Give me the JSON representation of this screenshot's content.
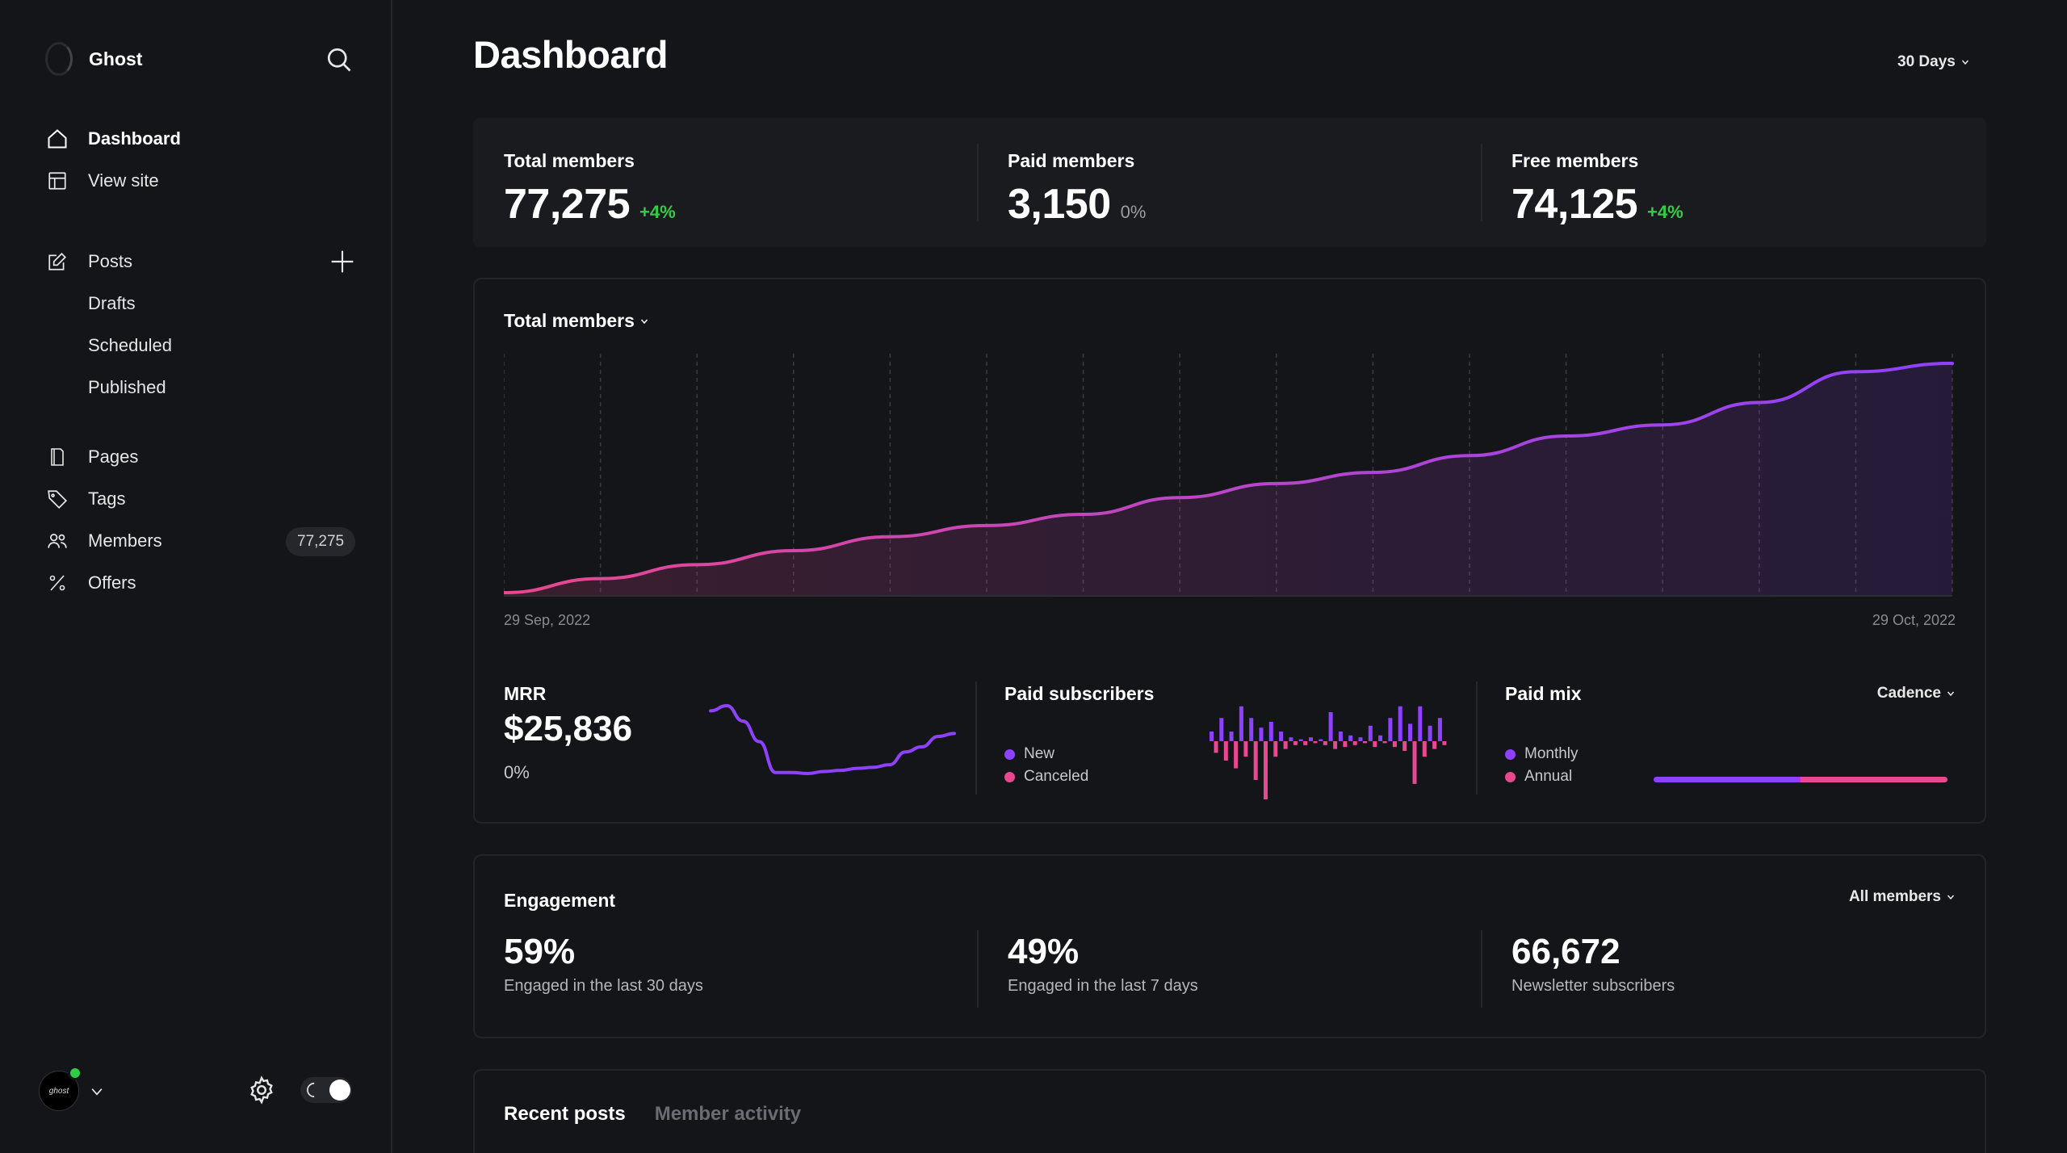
{
  "app": {
    "name": "Ghost"
  },
  "sidebar": {
    "nav_main": [
      {
        "label": "Dashboard",
        "icon": "home-icon"
      },
      {
        "label": "View site",
        "icon": "layout-icon"
      }
    ],
    "posts": {
      "label": "Posts",
      "sub": [
        "Drafts",
        "Scheduled",
        "Published"
      ]
    },
    "nav_secondary": [
      {
        "label": "Pages",
        "icon": "page-icon"
      },
      {
        "label": "Tags",
        "icon": "tag-icon"
      },
      {
        "label": "Members",
        "icon": "members-icon",
        "badge": "77,275"
      },
      {
        "label": "Offers",
        "icon": "percent-icon"
      }
    ],
    "avatar_text": "ghost"
  },
  "header": {
    "title": "Dashboard",
    "period": "30 Days"
  },
  "kpis": [
    {
      "label": "Total members",
      "value": "77,275",
      "delta": "+4%",
      "trend": "up"
    },
    {
      "label": "Paid members",
      "value": "3,150",
      "delta": "0%",
      "trend": "flat"
    },
    {
      "label": "Free members",
      "value": "74,125",
      "delta": "+4%",
      "trend": "up"
    }
  ],
  "members_chart": {
    "title": "Total members",
    "start_label": "29 Sep, 2022",
    "end_label": "29 Oct, 2022"
  },
  "mrr": {
    "label": "MRR",
    "value": "$25,836",
    "delta": "0%"
  },
  "paid_subscribers": {
    "label": "Paid subscribers",
    "legend": [
      "New",
      "Canceled"
    ]
  },
  "paid_mix": {
    "label": "Paid mix",
    "filter": "Cadence",
    "legend": [
      "Monthly",
      "Annual"
    ],
    "monthly_share": 0.5
  },
  "engagement": {
    "title": "Engagement",
    "filter": "All members",
    "stats": [
      {
        "value": "59%",
        "label": "Engaged in the last 30 days"
      },
      {
        "value": "49%",
        "label": "Engaged in the last 7 days"
      },
      {
        "value": "66,672",
        "label": "Newsletter subscribers"
      }
    ]
  },
  "recent": {
    "tabs": [
      "Recent posts",
      "Member activity"
    ]
  },
  "colors": {
    "purple": "#8e42ff",
    "pink": "#e8488f",
    "green": "#30cf43"
  },
  "chart_data": [
    {
      "type": "area",
      "title": "Total members",
      "x": [
        "29 Sep, 2022",
        "29 Oct, 2022"
      ],
      "series": [
        {
          "values": [
            74000,
            74250,
            74500,
            74750,
            75000,
            75200,
            75400,
            75700,
            75950,
            76150,
            76450,
            76800,
            77000,
            77400,
            77950,
            78100
          ]
        }
      ]
    },
    {
      "type": "line",
      "title": "MRR",
      "series": [
        {
          "values": [
            25880,
            25890,
            25860,
            25820,
            25760,
            25760,
            25758,
            25762,
            25764,
            25768,
            25770,
            25775,
            25800,
            25810,
            25830,
            25836
          ]
        }
      ]
    },
    {
      "type": "bar",
      "title": "Paid subscribers",
      "series": [
        {
          "name": "New",
          "values": [
            5,
            12,
            5,
            18,
            12,
            7,
            10,
            5,
            2,
            1,
            2,
            1,
            15,
            5,
            3,
            2,
            8,
            3,
            12,
            18,
            9,
            18,
            8,
            12
          ]
        },
        {
          "name": "Canceled",
          "values": [
            6,
            10,
            14,
            8,
            20,
            30,
            8,
            4,
            2,
            2,
            1,
            2,
            4,
            3,
            2,
            1,
            3,
            1,
            3,
            5,
            22,
            8,
            4,
            2
          ]
        }
      ]
    }
  ]
}
